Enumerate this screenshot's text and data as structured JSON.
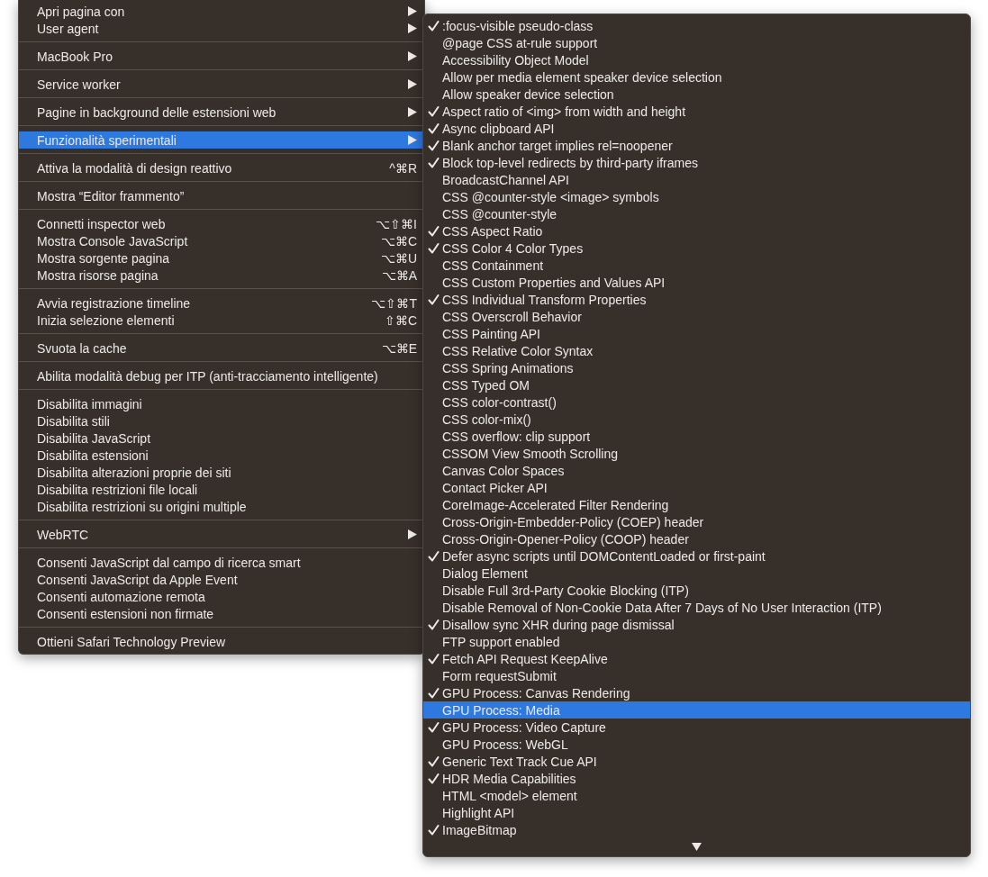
{
  "main_menu": {
    "groups": [
      {
        "items": [
          {
            "label": "Apri pagina con",
            "kind": "submenu",
            "selected": false
          },
          {
            "label": "User agent",
            "kind": "submenu",
            "selected": false
          }
        ]
      },
      {
        "items": [
          {
            "label": "MacBook Pro",
            "kind": "submenu",
            "selected": false
          }
        ]
      },
      {
        "items": [
          {
            "label": "Service worker",
            "kind": "submenu",
            "selected": false
          }
        ]
      },
      {
        "items": [
          {
            "label": "Pagine in background delle estensioni web",
            "kind": "submenu",
            "selected": false
          }
        ]
      },
      {
        "items": [
          {
            "label": "Funzionalità sperimentali",
            "kind": "submenu",
            "selected": true
          }
        ]
      },
      {
        "items": [
          {
            "label": "Attiva la modalità di design reattivo",
            "kind": "action",
            "shortcut": "^⌘R",
            "selected": false
          }
        ]
      },
      {
        "items": [
          {
            "label": "Mostra “Editor frammento”",
            "kind": "action",
            "selected": false
          }
        ]
      },
      {
        "items": [
          {
            "label": "Connetti inspector web",
            "kind": "action",
            "shortcut": "⌥⇧⌘I",
            "selected": false
          },
          {
            "label": "Mostra Console JavaScript",
            "kind": "action",
            "shortcut": "⌥⌘C",
            "selected": false
          },
          {
            "label": "Mostra sorgente pagina",
            "kind": "action",
            "shortcut": "⌥⌘U",
            "selected": false
          },
          {
            "label": "Mostra risorse pagina",
            "kind": "action",
            "shortcut": "⌥⌘A",
            "selected": false
          }
        ]
      },
      {
        "items": [
          {
            "label": "Avvia registrazione timeline",
            "kind": "action",
            "shortcut": "⌥⇧⌘T",
            "selected": false
          },
          {
            "label": "Inizia selezione elementi",
            "kind": "action",
            "shortcut": "⇧⌘C",
            "selected": false
          }
        ]
      },
      {
        "items": [
          {
            "label": "Svuota la cache",
            "kind": "action",
            "shortcut": "⌥⌘E",
            "selected": false
          }
        ]
      },
      {
        "items": [
          {
            "label": "Abilita modalità debug per ITP (anti-tracciamento intelligente)",
            "kind": "action",
            "selected": false
          }
        ]
      },
      {
        "items": [
          {
            "label": "Disabilita immagini",
            "kind": "action",
            "selected": false
          },
          {
            "label": "Disabilita stili",
            "kind": "action",
            "selected": false
          },
          {
            "label": "Disabilita JavaScript",
            "kind": "action",
            "selected": false
          },
          {
            "label": "Disabilita estensioni",
            "kind": "action",
            "selected": false
          },
          {
            "label": "Disabilita alterazioni proprie dei siti",
            "kind": "action",
            "selected": false
          },
          {
            "label": "Disabilita restrizioni file locali",
            "kind": "action",
            "selected": false
          },
          {
            "label": "Disabilita restrizioni su origini multiple",
            "kind": "action",
            "selected": false
          }
        ]
      },
      {
        "items": [
          {
            "label": "WebRTC",
            "kind": "submenu",
            "selected": false
          }
        ]
      },
      {
        "items": [
          {
            "label": "Consenti JavaScript dal campo di ricerca smart",
            "kind": "action",
            "selected": false
          },
          {
            "label": "Consenti JavaScript da Apple Event",
            "kind": "action",
            "selected": false
          },
          {
            "label": "Consenti automazione remota",
            "kind": "action",
            "selected": false
          },
          {
            "label": "Consenti estensioni non firmate",
            "kind": "action",
            "selected": false
          }
        ]
      },
      {
        "items": [
          {
            "label": "Ottieni Safari Technology Preview",
            "kind": "action",
            "selected": false
          }
        ]
      }
    ]
  },
  "submenu": {
    "items": [
      {
        "label": ":focus-visible pseudo-class",
        "checked": true,
        "selected": false
      },
      {
        "label": "@page CSS at-rule support",
        "checked": false,
        "selected": false
      },
      {
        "label": "Accessibility Object Model",
        "checked": false,
        "selected": false
      },
      {
        "label": "Allow per media element speaker device selection",
        "checked": false,
        "selected": false
      },
      {
        "label": "Allow speaker device selection",
        "checked": false,
        "selected": false
      },
      {
        "label": "Aspect ratio of <img> from width and height",
        "checked": true,
        "selected": false
      },
      {
        "label": "Async clipboard API",
        "checked": true,
        "selected": false
      },
      {
        "label": "Blank anchor target implies rel=noopener",
        "checked": true,
        "selected": false
      },
      {
        "label": "Block top-level redirects by third-party iframes",
        "checked": true,
        "selected": false
      },
      {
        "label": "BroadcastChannel API",
        "checked": false,
        "selected": false
      },
      {
        "label": "CSS @counter-style <image> symbols",
        "checked": false,
        "selected": false
      },
      {
        "label": "CSS @counter-style",
        "checked": false,
        "selected": false
      },
      {
        "label": "CSS Aspect Ratio",
        "checked": true,
        "selected": false
      },
      {
        "label": "CSS Color 4 Color Types",
        "checked": true,
        "selected": false
      },
      {
        "label": "CSS Containment",
        "checked": false,
        "selected": false
      },
      {
        "label": "CSS Custom Properties and Values API",
        "checked": false,
        "selected": false
      },
      {
        "label": "CSS Individual Transform Properties",
        "checked": true,
        "selected": false
      },
      {
        "label": "CSS Overscroll Behavior",
        "checked": false,
        "selected": false
      },
      {
        "label": "CSS Painting API",
        "checked": false,
        "selected": false
      },
      {
        "label": "CSS Relative Color Syntax",
        "checked": false,
        "selected": false
      },
      {
        "label": "CSS Spring Animations",
        "checked": false,
        "selected": false
      },
      {
        "label": "CSS Typed OM",
        "checked": false,
        "selected": false
      },
      {
        "label": "CSS color-contrast()",
        "checked": false,
        "selected": false
      },
      {
        "label": "CSS color-mix()",
        "checked": false,
        "selected": false
      },
      {
        "label": "CSS overflow: clip support",
        "checked": false,
        "selected": false
      },
      {
        "label": "CSSOM View Smooth Scrolling",
        "checked": false,
        "selected": false
      },
      {
        "label": "Canvas Color Spaces",
        "checked": false,
        "selected": false
      },
      {
        "label": "Contact Picker API",
        "checked": false,
        "selected": false
      },
      {
        "label": "CoreImage-Accelerated Filter Rendering",
        "checked": false,
        "selected": false
      },
      {
        "label": "Cross-Origin-Embedder-Policy (COEP) header",
        "checked": false,
        "selected": false
      },
      {
        "label": "Cross-Origin-Opener-Policy (COOP) header",
        "checked": false,
        "selected": false
      },
      {
        "label": "Defer async scripts until DOMContentLoaded or first-paint",
        "checked": true,
        "selected": false
      },
      {
        "label": "Dialog Element",
        "checked": false,
        "selected": false
      },
      {
        "label": "Disable Full 3rd-Party Cookie Blocking (ITP)",
        "checked": false,
        "selected": false
      },
      {
        "label": "Disable Removal of Non-Cookie Data After 7 Days of No User Interaction (ITP)",
        "checked": false,
        "selected": false
      },
      {
        "label": "Disallow sync XHR during page dismissal",
        "checked": true,
        "selected": false
      },
      {
        "label": "FTP support enabled",
        "checked": false,
        "selected": false
      },
      {
        "label": "Fetch API Request KeepAlive",
        "checked": true,
        "selected": false
      },
      {
        "label": "Form requestSubmit",
        "checked": false,
        "selected": false
      },
      {
        "label": "GPU Process: Canvas Rendering",
        "checked": true,
        "selected": false
      },
      {
        "label": "GPU Process: Media",
        "checked": false,
        "selected": true
      },
      {
        "label": "GPU Process: Video Capture",
        "checked": true,
        "selected": false
      },
      {
        "label": "GPU Process: WebGL",
        "checked": false,
        "selected": false
      },
      {
        "label": "Generic Text Track Cue API",
        "checked": true,
        "selected": false
      },
      {
        "label": "HDR Media Capabilities",
        "checked": true,
        "selected": false
      },
      {
        "label": "HTML <model> element",
        "checked": false,
        "selected": false
      },
      {
        "label": "Highlight API",
        "checked": false,
        "selected": false
      },
      {
        "label": "ImageBitmap",
        "checked": true,
        "selected": false
      }
    ]
  }
}
